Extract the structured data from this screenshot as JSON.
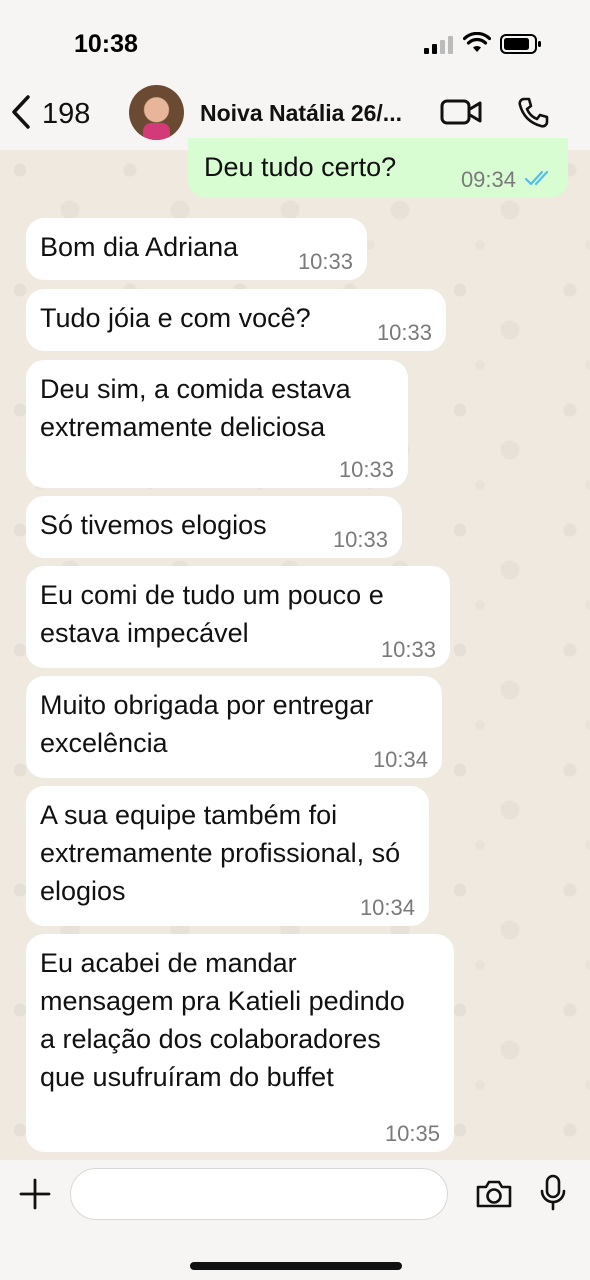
{
  "status_bar": {
    "time": "10:38"
  },
  "header": {
    "back_count": "198",
    "contact_name": "Noiva Natália 26/...",
    "icons": [
      "chevron-left-icon",
      "video-call-icon",
      "phone-icon"
    ]
  },
  "messages": [
    {
      "direction": "out",
      "text": "Deu tudo certo?",
      "time": "09:34",
      "status": "read"
    },
    {
      "direction": "in",
      "text": "Bom dia Adriana",
      "time": "10:33"
    },
    {
      "direction": "in",
      "text": "Tudo jóia e com você?",
      "time": "10:33"
    },
    {
      "direction": "in",
      "text": "Deu sim, a comida estava extremamente deliciosa",
      "time": "10:33"
    },
    {
      "direction": "in",
      "text": "Só tivemos elogios",
      "time": "10:33"
    },
    {
      "direction": "in",
      "text": "Eu comi de tudo um pouco e estava impecável",
      "time": "10:33"
    },
    {
      "direction": "in",
      "text": "Muito obrigada por entregar excelência",
      "time": "10:34"
    },
    {
      "direction": "in",
      "text": "A sua equipe também foi extremamente profissional, só elogios",
      "time": "10:34"
    },
    {
      "direction": "in",
      "text": "Eu acabei de mandar mensagem pra Katieli pedindo a relação dos colaboradores que usufruíram do buffet",
      "time": "10:35"
    }
  ],
  "input": {
    "value": "",
    "icons": [
      "plus-icon",
      "sticker-icon",
      "camera-icon",
      "microphone-icon"
    ]
  },
  "colors": {
    "outgoing_bubble": "#d9fdd3",
    "incoming_bubble": "#ffffff",
    "read_tick": "#53bdeb",
    "background": "#efeae2"
  }
}
